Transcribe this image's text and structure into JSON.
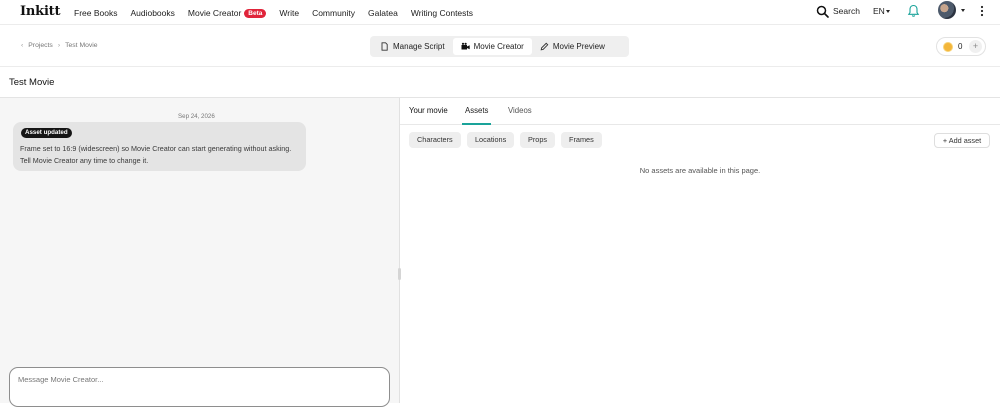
{
  "nav": {
    "logo": "Inkitt",
    "links": [
      "Free Books",
      "Audiobooks",
      "Movie Creator",
      "Write",
      "Community",
      "Galatea",
      "Writing Contests"
    ],
    "beta_badge": "Beta",
    "search_label": "Search",
    "language": "EN",
    "icons": [
      "search-icon",
      "bell-icon",
      "kebab-icon"
    ]
  },
  "breadcrumb": {
    "items": [
      "Projects",
      "Test Movie"
    ]
  },
  "modes": {
    "tabs": [
      "Manage Script",
      "Movie Creator",
      "Movie Preview"
    ],
    "active": "Movie Creator"
  },
  "credits": {
    "count": "0",
    "add": "+"
  },
  "page": {
    "title": "Test Movie"
  },
  "chat": {
    "date": "Sep 24, 2026",
    "messages": [
      {
        "badge": "Asset updated",
        "text": "Frame set to 16:9 (widescreen) so Movie Creator can start generating without asking. Tell Movie Creator any time to change it."
      }
    ],
    "input_placeholder": "Message Movie Creator..."
  },
  "panel": {
    "tabs": [
      "Your movie",
      "Assets",
      "Videos"
    ],
    "active_tab": "Assets",
    "filters": [
      "Characters",
      "Locations",
      "Props",
      "Frames"
    ],
    "add_asset_label": "+ Add asset",
    "empty_message": "No assets are available in this page."
  },
  "colors": {
    "beta_badge": "#e0243a",
    "tab_underline": "#1aa39a",
    "coin": "#f3b63a"
  }
}
